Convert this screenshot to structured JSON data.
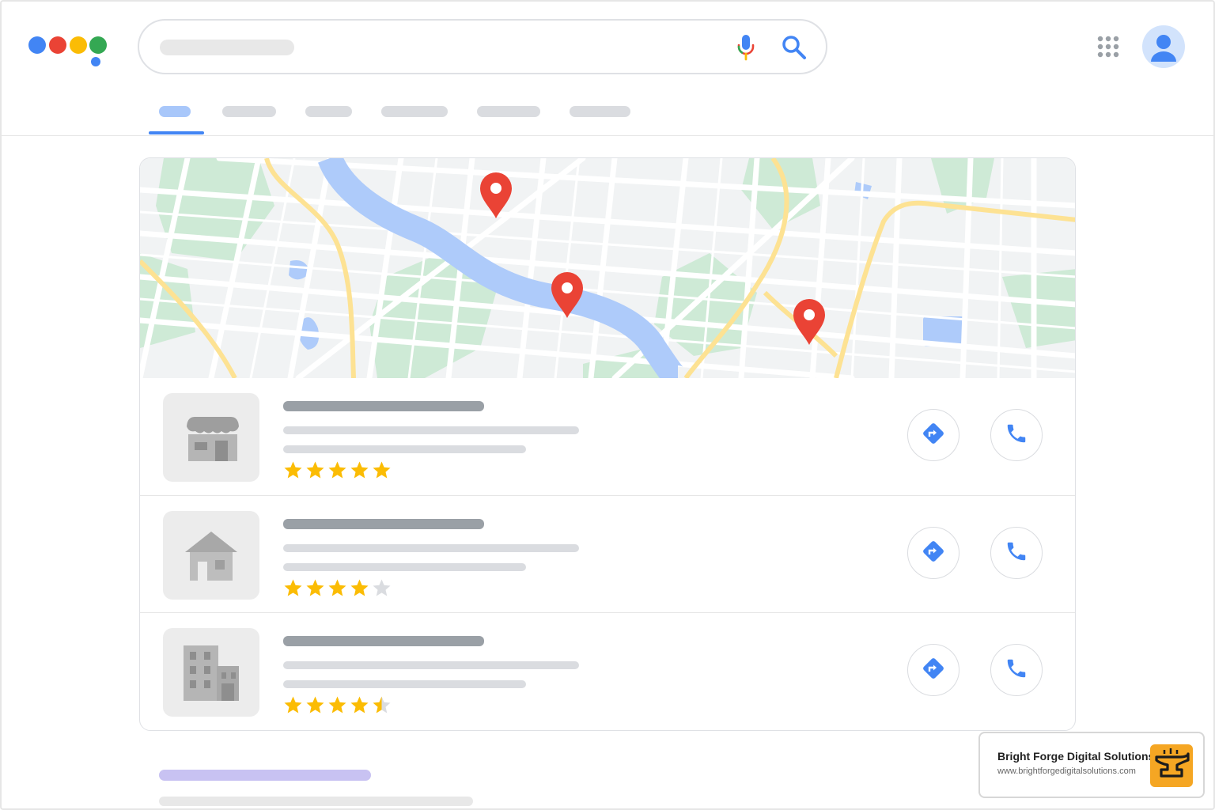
{
  "search": {
    "value": "",
    "placeholder": ""
  },
  "icons": {
    "logo": "multicolor-dots-logo",
    "mic": "microphone-icon",
    "search": "magnifier-icon",
    "apps": "apps-grid-icon",
    "account": "user-avatar-icon",
    "directions": "directions-icon",
    "call": "phone-icon",
    "pin": "map-pin-icon",
    "store": "storefront-icon",
    "house": "house-icon",
    "office": "office-building-icon"
  },
  "colors": {
    "brand_blue": "#4285f4",
    "brand_red": "#ea4335",
    "brand_yellow": "#fbbc05",
    "brand_green": "#34a853",
    "pin": "#ea4335",
    "star": "#fbbc04",
    "star_empty": "#dadce0",
    "action_icon": "#4285f4",
    "water": "#aecbfa",
    "park": "#ceead6",
    "highway": "#fde293",
    "watermark_logo": "#f5a623"
  },
  "tabs": {
    "count": 6,
    "active_index": 0
  },
  "results": [
    {
      "thumbnail_icon": "storefront-icon",
      "rating": 5
    },
    {
      "thumbnail_icon": "house-icon",
      "rating": 4
    },
    {
      "thumbnail_icon": "office-building-icon",
      "rating": 4.5
    }
  ],
  "map": {
    "pin_count": 3
  },
  "watermark": {
    "name": "Bright Forge Digital Solutions",
    "url": "www.brightforgedigitalsolutions.com",
    "logo_icon": "anvil-logo-icon"
  }
}
